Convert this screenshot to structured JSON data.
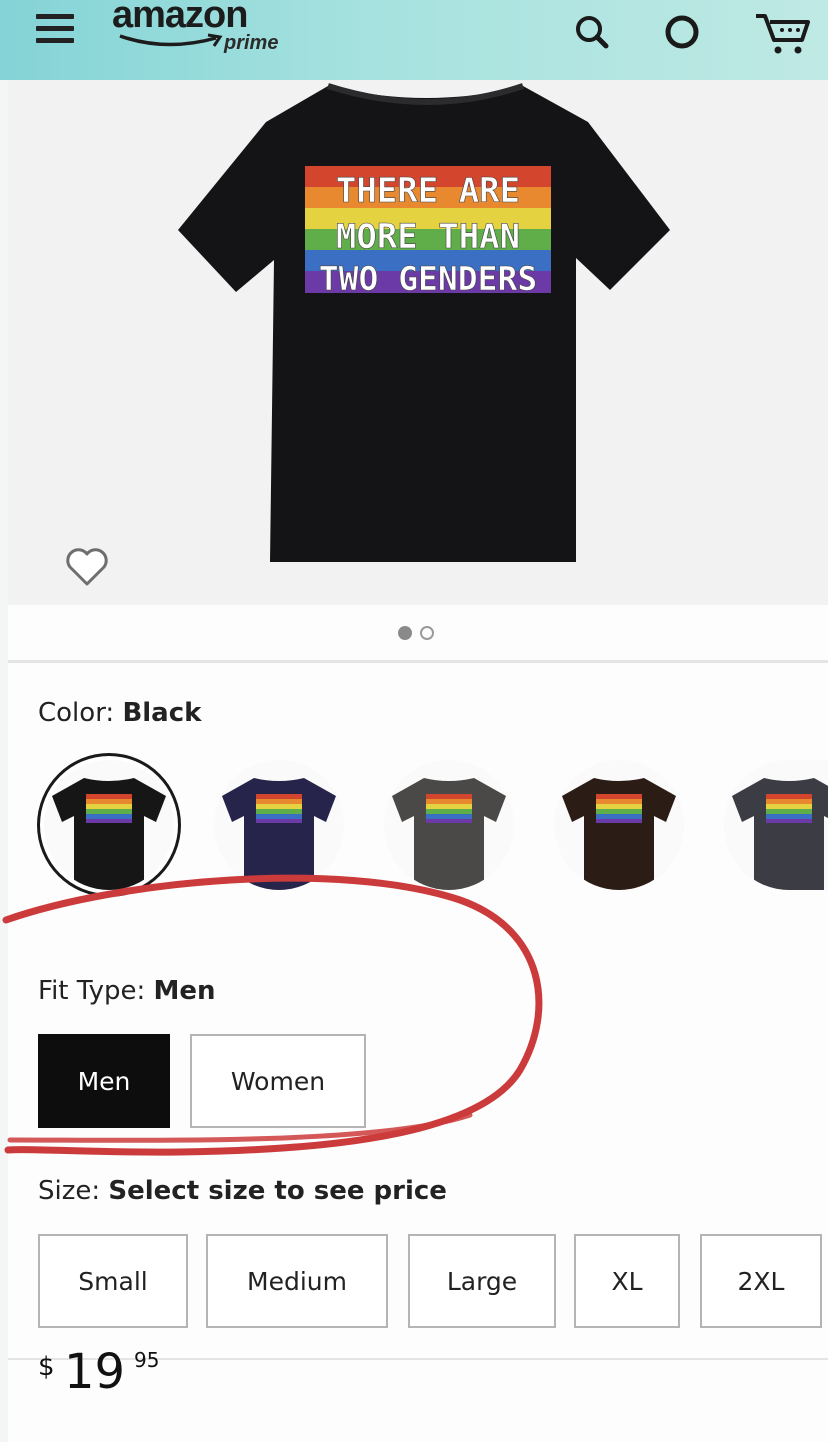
{
  "header": {
    "logo_word": "amazon",
    "logo_sub": "prime",
    "icons": [
      "menu-icon",
      "search-icon",
      "alexa-ring-icon",
      "cart-icon"
    ],
    "background": "#a6e2df"
  },
  "product": {
    "shirt_print": [
      "THERE ARE",
      "MORE THAN",
      "TWO GENDERS"
    ],
    "image_pager": {
      "count": 2,
      "active": 1
    }
  },
  "color": {
    "label": "Color:",
    "selected": "Black",
    "swatches": [
      {
        "name": "Black",
        "hex": "#161616"
      },
      {
        "name": "Navy",
        "hex": "#26244a"
      },
      {
        "name": "Dark Heather",
        "hex": "#4a4948"
      },
      {
        "name": "Brown",
        "hex": "#2c1c16"
      },
      {
        "name": "Asphalt",
        "hex": "#3b3c44"
      }
    ]
  },
  "fit": {
    "label": "Fit Type:",
    "selected": "Men",
    "options": [
      "Men",
      "Women"
    ]
  },
  "size": {
    "label": "Size:",
    "prompt": "Select size to see price",
    "options": [
      "Small",
      "Medium",
      "Large",
      "XL",
      "2XL"
    ]
  },
  "price": {
    "currency": "$",
    "whole": "19",
    "fraction": "95"
  },
  "annotation_color": "#cc3b3b"
}
